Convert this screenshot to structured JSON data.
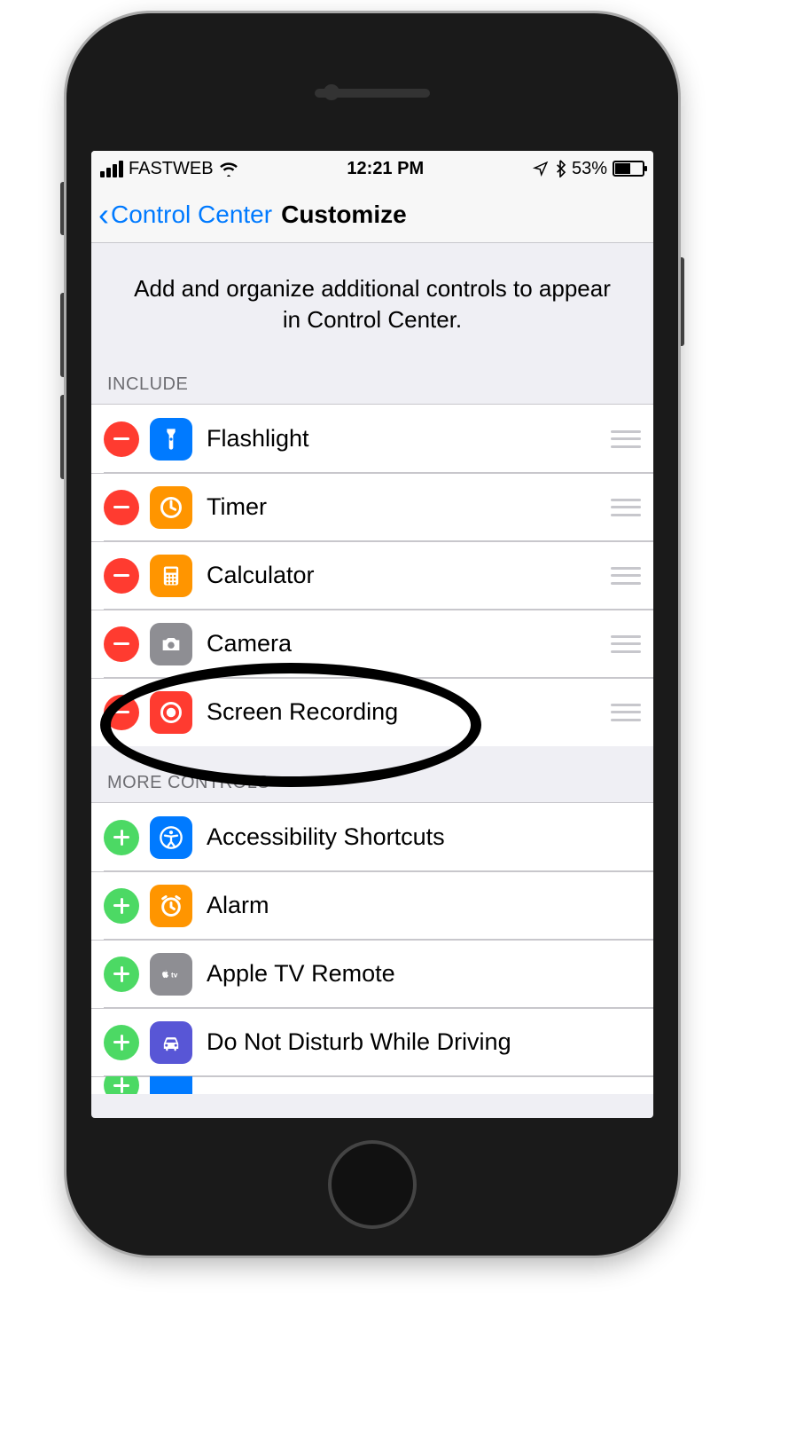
{
  "status": {
    "carrier": "FASTWEB",
    "time": "12:21 PM",
    "battery_text": "53%"
  },
  "nav": {
    "back_label": "Control Center",
    "title": "Customize"
  },
  "intro": "Add and organize additional controls to appear in Control Center.",
  "sections": {
    "include_header": "INCLUDE",
    "more_header": "MORE CONTROLS"
  },
  "include": [
    {
      "label": "Flashlight"
    },
    {
      "label": "Timer"
    },
    {
      "label": "Calculator"
    },
    {
      "label": "Camera"
    },
    {
      "label": "Screen Recording"
    }
  ],
  "more": [
    {
      "label": "Accessibility Shortcuts"
    },
    {
      "label": "Alarm"
    },
    {
      "label": "Apple TV Remote"
    },
    {
      "label": "Do Not Disturb While Driving"
    }
  ],
  "annotation": {
    "circled_item": "Screen Recording"
  }
}
